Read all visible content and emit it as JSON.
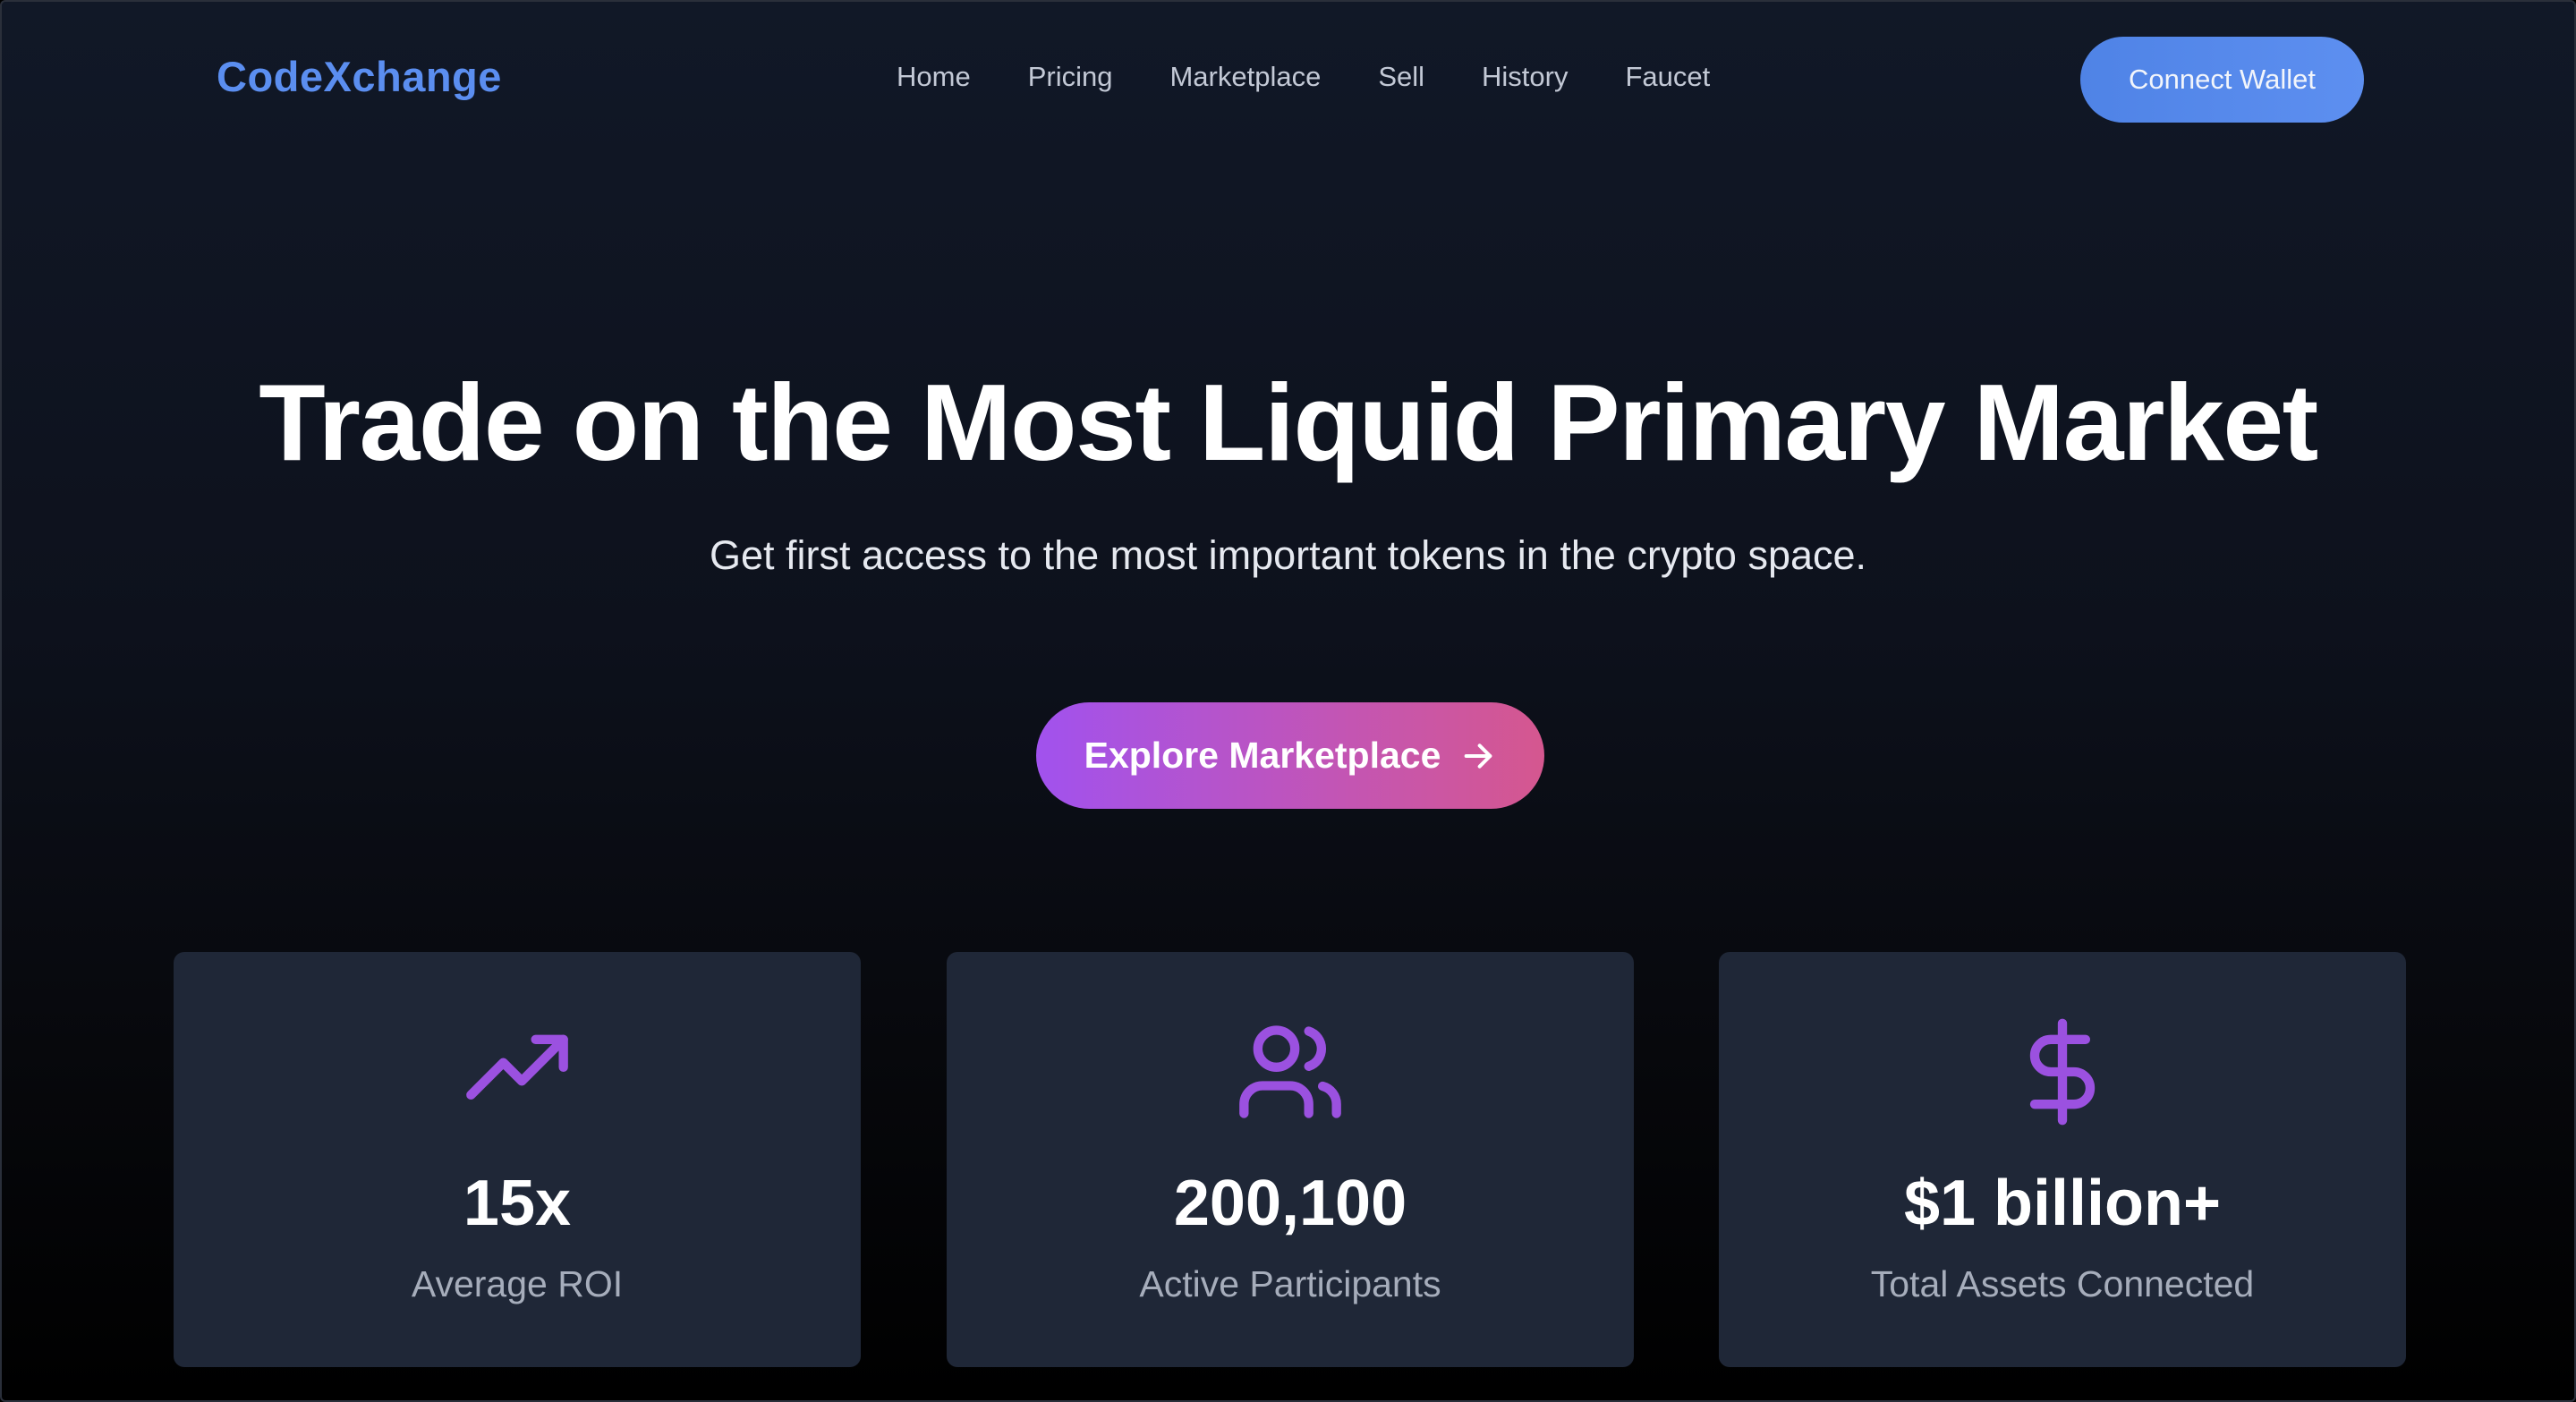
{
  "brand": {
    "name": "CodeXchange",
    "color": "#5b8ef0"
  },
  "nav": {
    "items": [
      {
        "label": "Home"
      },
      {
        "label": "Pricing"
      },
      {
        "label": "Marketplace"
      },
      {
        "label": "Sell"
      },
      {
        "label": "History"
      },
      {
        "label": "Faucet"
      }
    ]
  },
  "header": {
    "connect_label": "Connect Wallet"
  },
  "hero": {
    "title": "Trade on the Most Liquid Primary Market",
    "subtitle": "Get first access to the most important tokens in the crypto space.",
    "cta_label": "Explore Marketplace",
    "cta_icon": "arrow-right-icon"
  },
  "stats": [
    {
      "icon": "trending-up-icon",
      "value": "15x",
      "label": "Average ROI"
    },
    {
      "icon": "users-icon",
      "value": "200,100",
      "label": "Active Participants"
    },
    {
      "icon": "dollar-sign-icon",
      "value": "$1 billion+",
      "label": "Total Assets Connected"
    }
  ],
  "colors": {
    "accent_purple": "#9b51e0",
    "button_blue": "#5b8ef0",
    "card_bg": "#1f2737",
    "cta_gradient_start": "#a152ee",
    "cta_gradient_end": "#d5578f"
  }
}
